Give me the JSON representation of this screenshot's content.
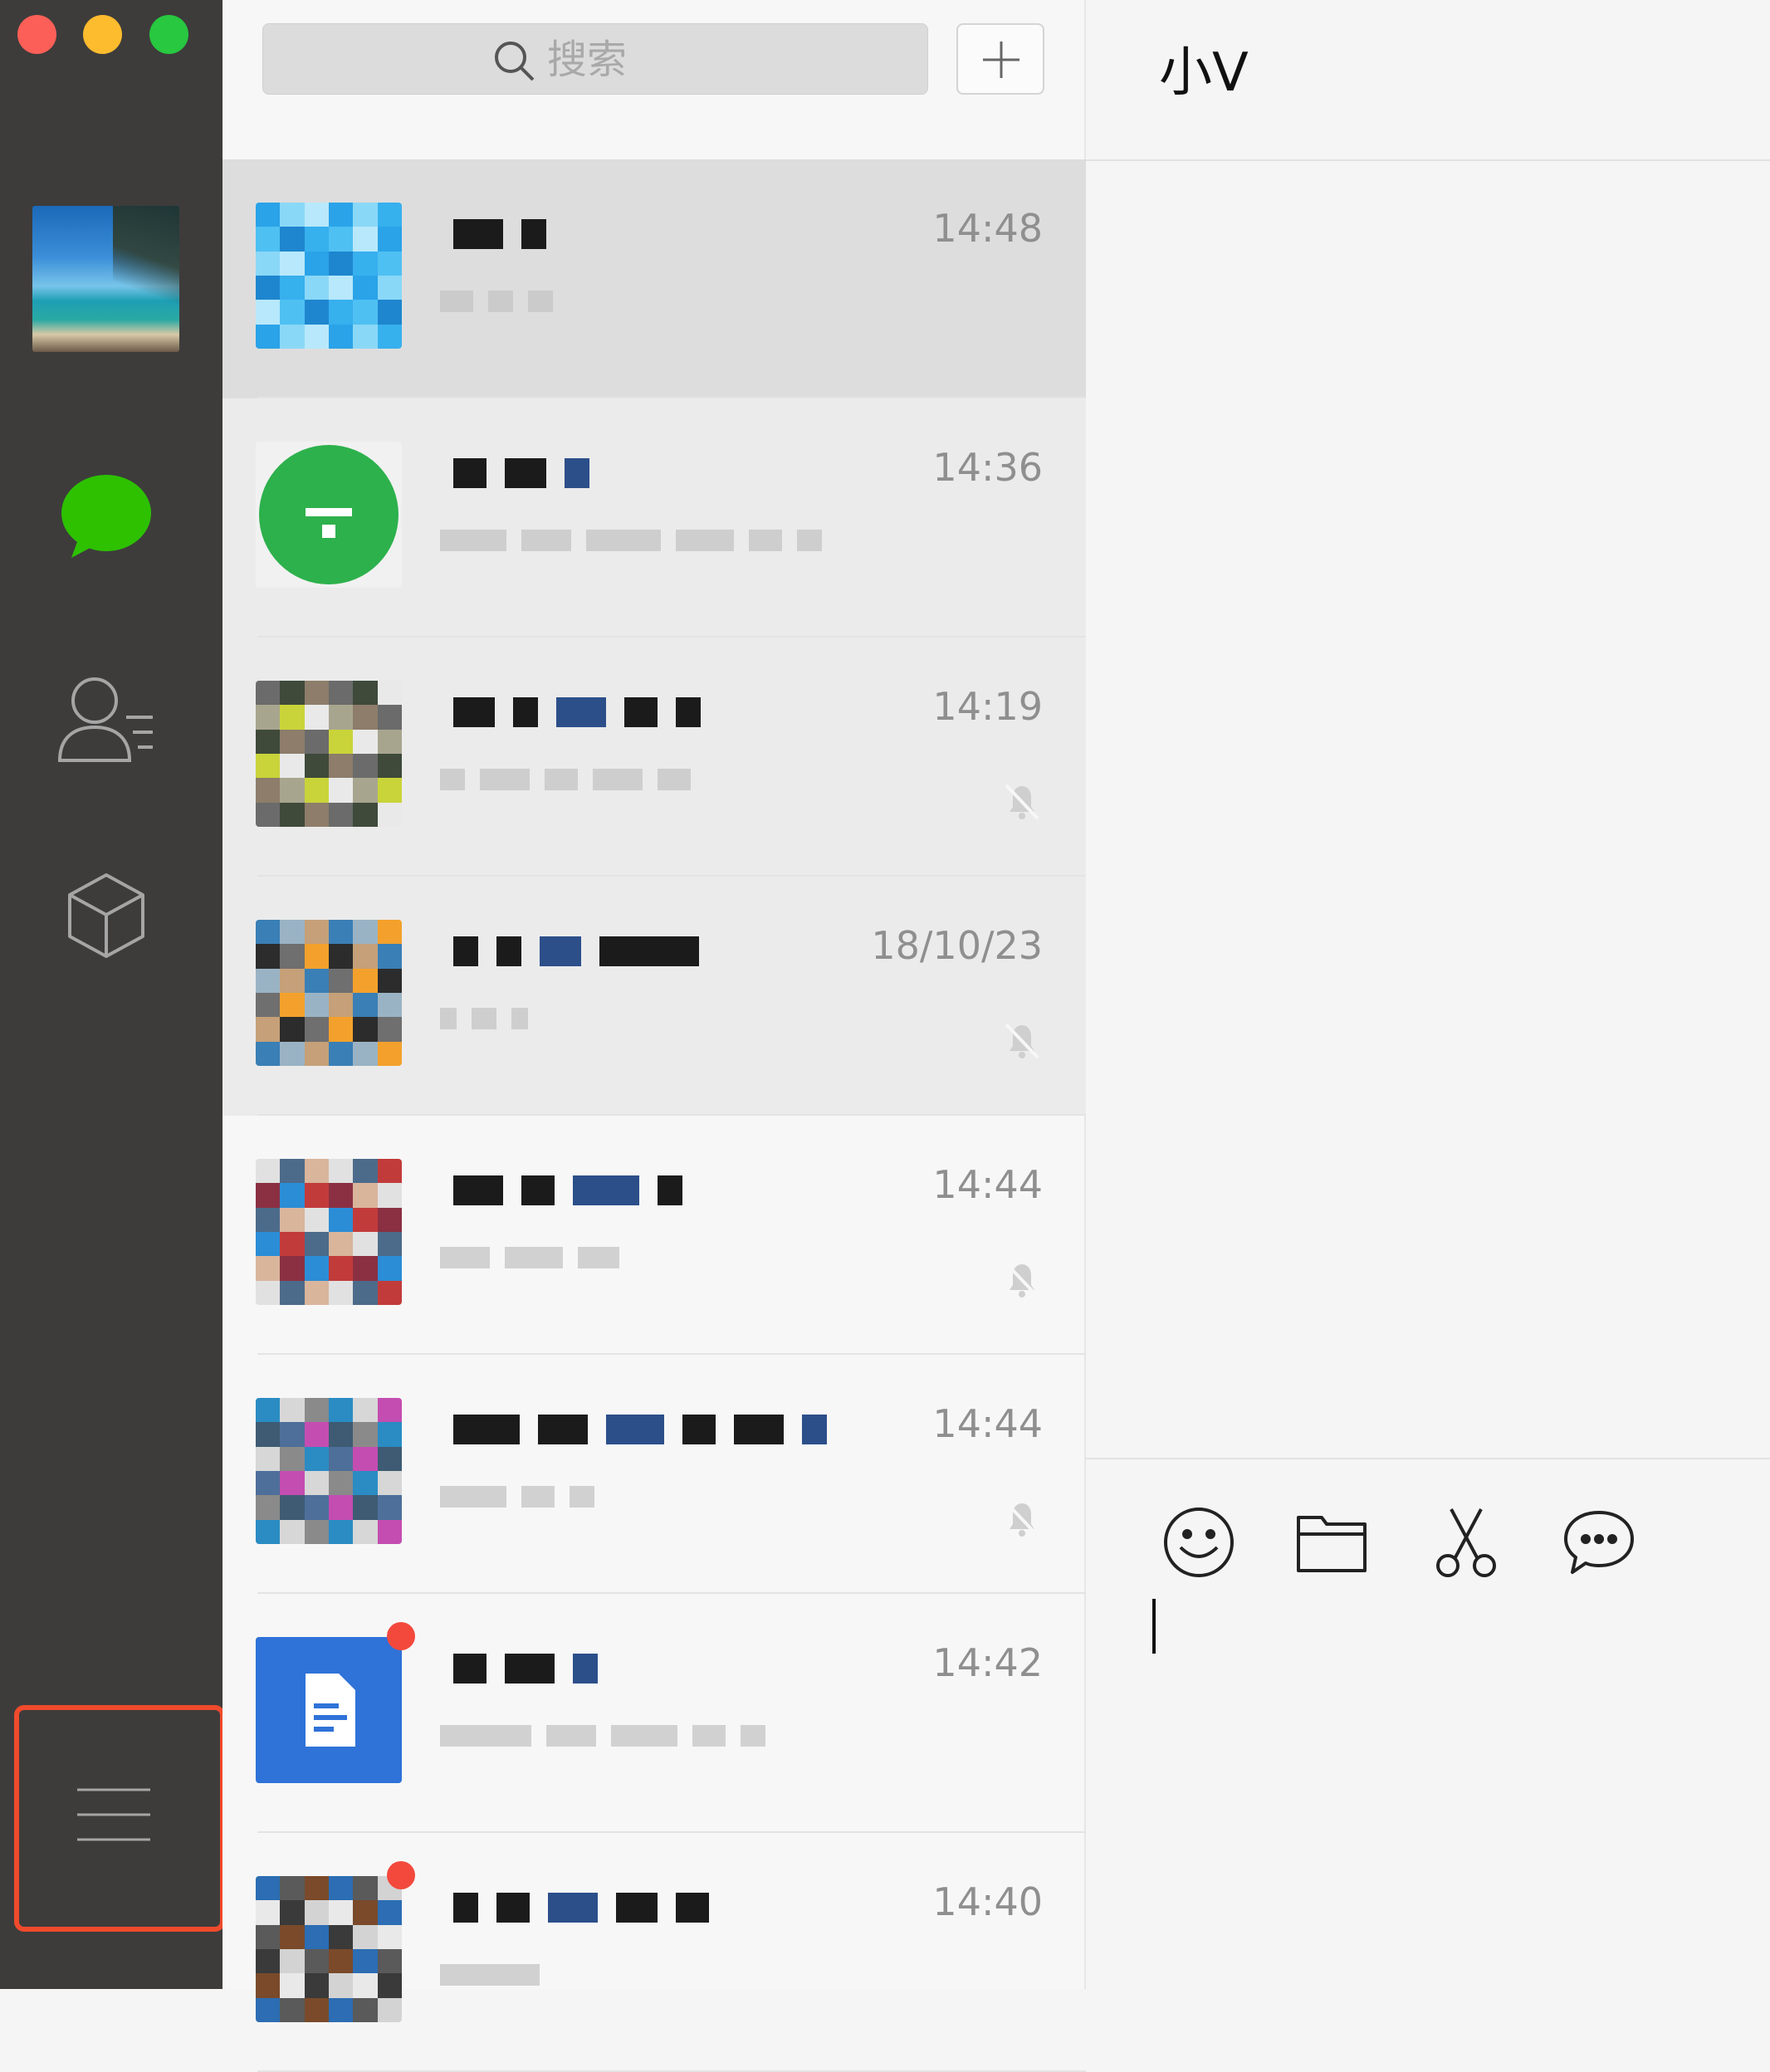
{
  "sidebar": {
    "icons": [
      "chat-bubble-icon",
      "contacts-icon",
      "box-icon",
      "menu-icon"
    ],
    "accent_color": "#2dc100"
  },
  "search": {
    "placeholder": "搜索",
    "add_label": "+"
  },
  "conversations": [
    {
      "time": "14:48",
      "muted": false,
      "selected": true
    },
    {
      "time": "14:36",
      "muted": false
    },
    {
      "time": "14:19",
      "muted": true
    },
    {
      "time": "18/10/23",
      "muted": true
    },
    {
      "time": "14:44",
      "muted": true
    },
    {
      "time": "14:44",
      "muted": true
    },
    {
      "time": "14:42",
      "muted": false,
      "badge": true
    },
    {
      "time": "14:40",
      "muted": false,
      "badge": true
    }
  ],
  "chat": {
    "title": "小V",
    "toolbar": [
      "emoji-icon",
      "folder-icon",
      "scissors-icon",
      "chat-history-icon"
    ]
  },
  "colors": {
    "highlight_border": "#f04a2c",
    "sidebar_bg": "#3d3c3b"
  }
}
